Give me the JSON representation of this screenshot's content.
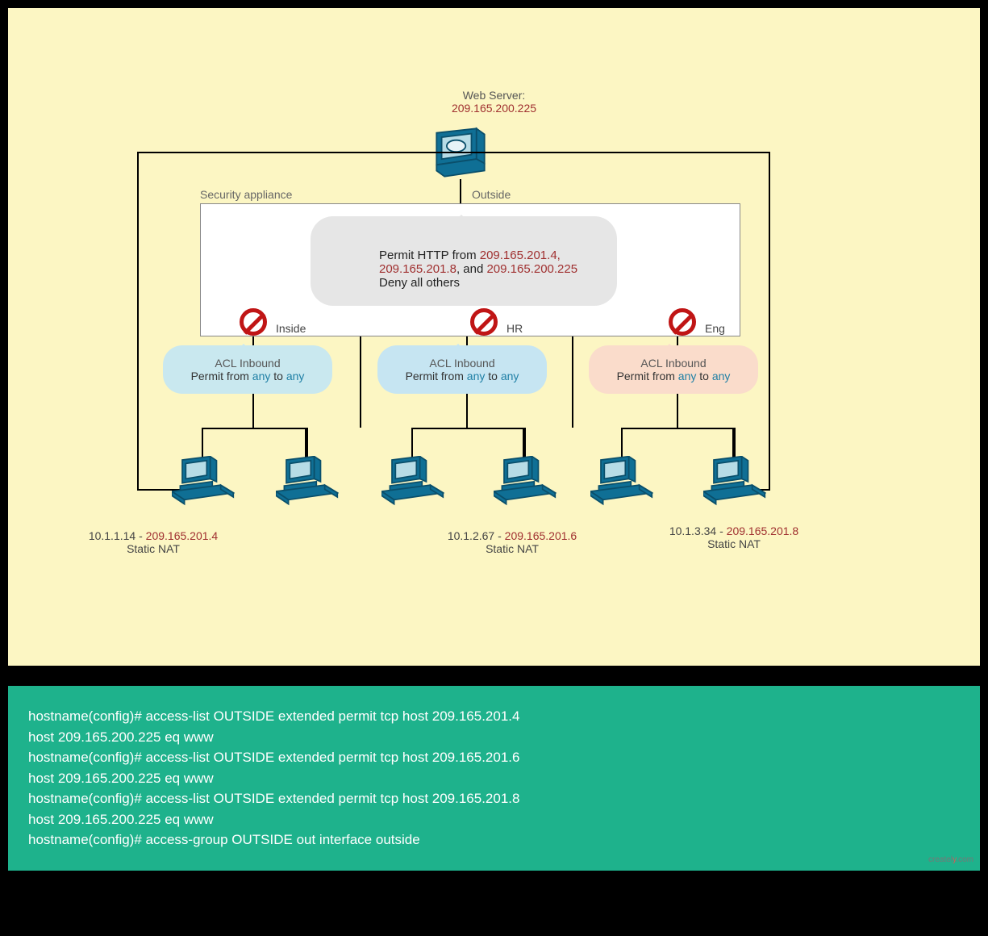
{
  "diagram": {
    "webserver": {
      "title": "Web Server:",
      "ip": "209.165.200.225"
    },
    "appliance_label": "Security appliance",
    "outside_label": "Outside",
    "permit_callout": {
      "l1a": "Permit HTTP from ",
      "ip1": "209.165.201.4,",
      "ip2": "209.165.201.8",
      "mid": ", and ",
      "ip3": "209.165.200.225",
      "l3": "Deny all others"
    },
    "ifaces": {
      "inside": "Inside",
      "hr": "HR",
      "eng": "Eng"
    },
    "acl": {
      "title": "ACL Inbound",
      "pfx": "Permit from ",
      "any": "any",
      "to": " to "
    },
    "hosts": {
      "h1": {
        "local": "10.1.1.14",
        "dash": " - ",
        "nat": "209.165.201.4",
        "sub": "Static NAT"
      },
      "h2": {
        "local": "10.1.2.67",
        "dash": " - ",
        "nat": "209.165.201.6",
        "sub": "Static NAT"
      },
      "h3": {
        "local": "10.1.3.34",
        "dash": " - ",
        "nat": "209.165.201.8",
        "sub": "Static NAT"
      }
    }
  },
  "code": {
    "l1": "hostname(config)# access-list OUTSIDE extended permit tcp host 209.165.201.4",
    "l2": "host 209.165.200.225 eq www",
    "l3": "hostname(config)# access-list OUTSIDE extended permit tcp host 209.165.201.6",
    "l4": "host 209.165.200.225 eq www",
    "l5": "hostname(config)# access-list OUTSIDE extended permit tcp host 209.165.201.8",
    "l6": "host 209.165.200.225 eq www",
    "l7": "hostname(config)# access-group OUTSIDE out interface outside"
  },
  "watermark": {
    "a": "create",
    "b": "l",
    "c": "y",
    "d": ".com"
  }
}
